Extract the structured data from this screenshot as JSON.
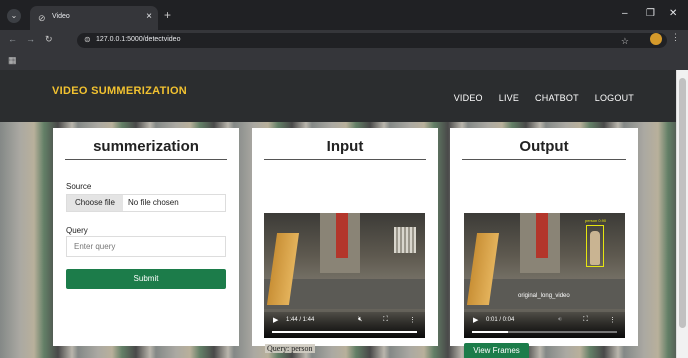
{
  "browser": {
    "tab_title": "Video",
    "url": "127.0.0.1:5000/detectvideo",
    "icons": {
      "tab_menu": "chevron-down-icon",
      "tab_favicon": "globe-icon",
      "tab_close": "close-icon",
      "new_tab": "plus-icon",
      "back": "arrow-left-icon",
      "forward": "arrow-right-icon",
      "reload": "reload-icon",
      "site_info": "site-info-icon",
      "bookmark": "star-icon",
      "profile": "profile-avatar",
      "menu": "kebab-menu-icon",
      "apps": "apps-grid-icon"
    }
  },
  "navbar": {
    "brand": "VIDEO SUMMERIZATION",
    "links": [
      "VIDEO",
      "LIVE",
      "CHATBOT",
      "LOGOUT"
    ],
    "brand_color": "#f2c230",
    "background": "#2b2d2f"
  },
  "form_card": {
    "heading": "summerization",
    "source_label": "Source",
    "file_button": "Choose file",
    "file_status": "No file chosen",
    "query_label": "Query",
    "query_placeholder": "Enter query",
    "query_value": "",
    "submit_label": "Submit",
    "accent_color": "#1c7c4a"
  },
  "input_card": {
    "heading": "Input",
    "video": {
      "time": "1:44 / 1:44",
      "progress": 1.0
    }
  },
  "output_card": {
    "heading": "Output",
    "video": {
      "time": "0:01 / 0:04",
      "progress": 0.25,
      "overlay_text": "original_long_video",
      "detection_label": "person 0.90"
    },
    "view_frames_label": "View Frames"
  },
  "query_result": "Query: person"
}
